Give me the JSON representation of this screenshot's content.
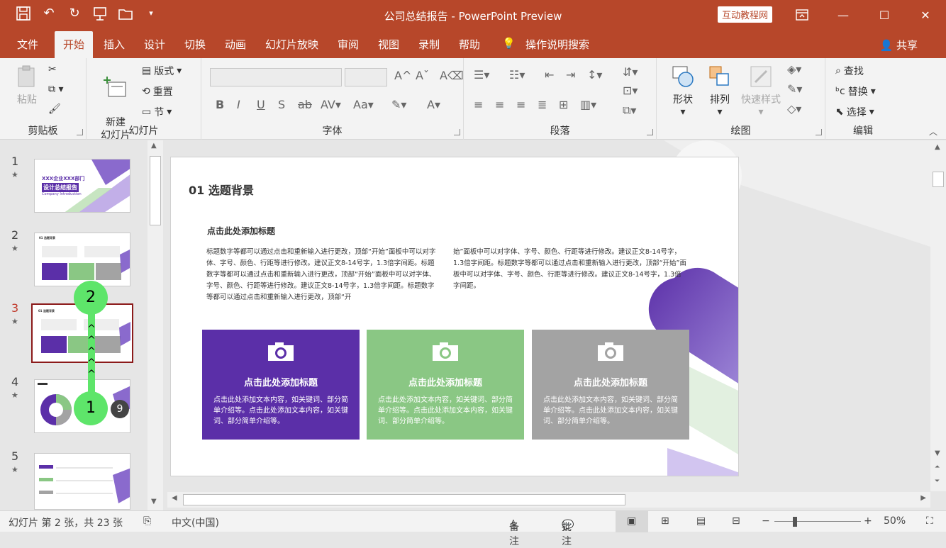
{
  "window": {
    "title": "公司总结报告 - PowerPoint Preview",
    "site_badge": "互动教程网"
  },
  "tabs": [
    {
      "label": "文件"
    },
    {
      "label": "开始"
    },
    {
      "label": "插入"
    },
    {
      "label": "设计"
    },
    {
      "label": "切换"
    },
    {
      "label": "动画"
    },
    {
      "label": "幻灯片放映"
    },
    {
      "label": "审阅"
    },
    {
      "label": "视图"
    },
    {
      "label": "录制"
    },
    {
      "label": "帮助"
    },
    {
      "label": "操作说明搜索"
    }
  ],
  "share_label": "共享",
  "ribbon": {
    "clipboard": {
      "label": "剪贴板",
      "paste": "粘贴"
    },
    "slides": {
      "label": "幻灯片",
      "new_slide": "新建\n幻灯片",
      "layout": "版式",
      "reset": "重置",
      "section": "节"
    },
    "font": {
      "label": "字体"
    },
    "paragraph": {
      "label": "段落"
    },
    "drawing": {
      "label": "绘图",
      "shapes": "形状",
      "arrange": "排列",
      "quick_styles": "快速样式"
    },
    "editing": {
      "label": "编辑",
      "find": "查找",
      "replace": "替换",
      "select": "选择"
    }
  },
  "thumbnails": [
    {
      "num": "1",
      "title": "XXX企业XXX部门",
      "subtitle": "设计总结报告",
      "sub2": "Company Introduction"
    },
    {
      "num": "2",
      "head": "01 选题背景"
    },
    {
      "num": "3",
      "head": "01 选题背景"
    },
    {
      "num": "4"
    },
    {
      "num": "5"
    }
  ],
  "markers": {
    "m1": "2",
    "m2": "1",
    "m3": "9",
    "arrows": "^"
  },
  "slide": {
    "heading": "01 选题背景",
    "subheading": "点击此处添加标题",
    "para1": "标题数字等都可以通过点击和重新输入进行更改，顶部“开始”面板中可以对字体、字号、颜色、行距等进行修改。建议正文8-14号字，1.3倍字间距。标题数字等都可以通过点击和重新输入进行更改，顶部“开始”面板中可以对字体、字号、颜色、行距等进行修改。建议正文8-14号字，1.3倍字间距。标题数字等都可以通过点击和重新输入进行更改，顶部“开",
    "para2": "始”面板中可以对字体、字号、颜色、行距等进行修改。建议正文8-14号字，1.3倍字间距。标题数字等都可以通过点击和重新输入进行更改，顶部“开始”面板中可以对字体、字号、颜色、行距等进行修改。建议正文8-14号字，1.3倍字间距。",
    "cards": [
      {
        "title": "点击此处添加标题",
        "body": "点击此处添加文本内容，如关键词、部分简单介绍等。点击此处添加文本内容，如关键词、部分简单介绍等。",
        "color": "#5b2fa8"
      },
      {
        "title": "点击此处添加标题",
        "body": "点击此处添加文本内容，如关键词、部分简单介绍等。点击此处添加文本内容，如关键词、部分简单介绍等。",
        "color": "#8ac784"
      },
      {
        "title": "点击此处添加标题",
        "body": "点击此处添加文本内容，如关键词、部分简单介绍等。点击此处添加文本内容，如关键词、部分简单介绍等。",
        "color": "#a3a3a3"
      }
    ]
  },
  "status": {
    "slide_info": "幻灯片 第 2 张，共 23 张",
    "language": "中文(中国)",
    "notes": "备注",
    "comments": "批注",
    "zoom": "50%"
  },
  "colors": {
    "accent": "#b7472a",
    "purple": "#5b2fa8",
    "green": "#8ac784"
  }
}
